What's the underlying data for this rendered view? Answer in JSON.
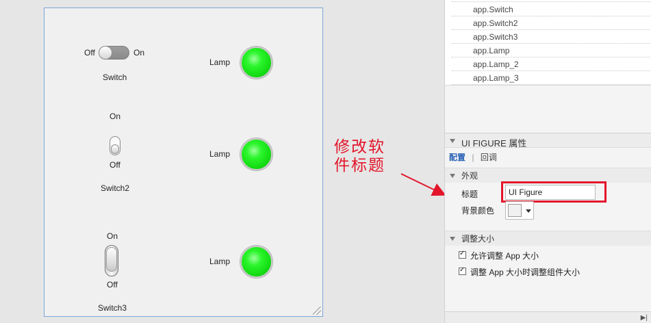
{
  "figure": {
    "switch1": {
      "off_label": "Off",
      "on_label": "On",
      "name": "Switch"
    },
    "switch2": {
      "on_label": "On",
      "off_label": "Off",
      "name": "Switch2"
    },
    "switch3": {
      "on_label": "On",
      "off_label": "Off",
      "name": "Switch3"
    },
    "lamps": [
      {
        "label": "Lamp",
        "color": "#1aeb1a"
      },
      {
        "label": "Lamp",
        "color": "#1aeb1a"
      },
      {
        "label": "Lamp",
        "color": "#1aeb1a"
      }
    ]
  },
  "annotation": {
    "line1": "修改软",
    "line2": "件标题",
    "color": "#e3152a"
  },
  "component_tree": {
    "items": [
      "app.Switch",
      "app.Switch2",
      "app.Switch3",
      "app.Lamp",
      "app.Lamp_2",
      "app.Lamp_3"
    ]
  },
  "inspector": {
    "title": "UI FIGURE 属性",
    "tabs": {
      "config": "配置",
      "callbacks": "回调"
    },
    "appearance": {
      "header": "外观",
      "title_label": "标题",
      "title_value": "UI Figure",
      "bgcolor_label": "背景颜色"
    },
    "resize": {
      "header": "调整大小",
      "allow_resize": "允许调整 App 大小",
      "resize_children": "调整 App 大小时调整组件大小"
    }
  },
  "highlight_color": "#e3152a"
}
